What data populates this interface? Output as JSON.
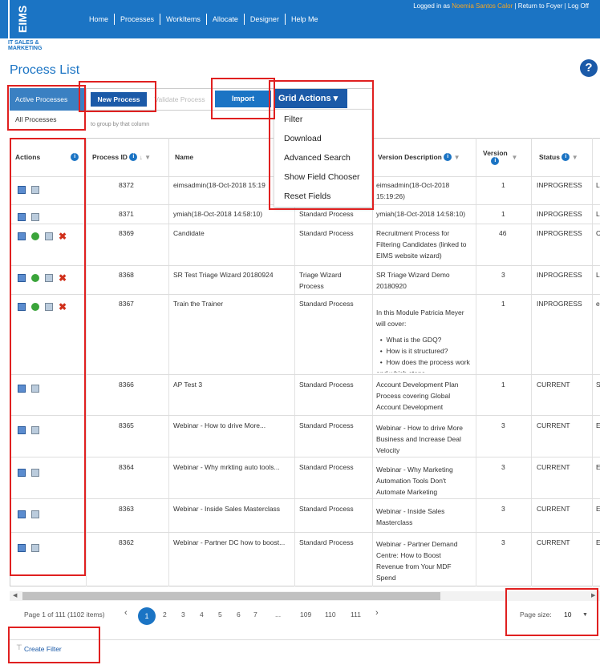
{
  "header": {
    "logo": "EIMS",
    "logo_sub": "IT SALES & MARKETING",
    "nav": [
      "Home",
      "Processes",
      "WorkItems",
      "Allocate",
      "Designer",
      "Help Me"
    ],
    "user_prefix": "Logged in as ",
    "user_name": "Noemia Santos Calor",
    "user_links": " | Return to Foyer | Log Off"
  },
  "page": {
    "title": "Process List",
    "help": "?"
  },
  "tabs": {
    "active": "Active Processes",
    "all": "All Processes"
  },
  "toolbar": {
    "new_process": "New Process",
    "validate": "Validate Process",
    "import": "Import",
    "grid_actions": "Grid Actions ▾",
    "group_hint": "to group by that column"
  },
  "grid_menu": [
    "Filter",
    "Download",
    "Advanced Search",
    "Show Field Chooser",
    "Reset Fields"
  ],
  "columns": {
    "actions": "Actions",
    "process_id": "Process ID",
    "name": "Name",
    "version_description": "Version Description",
    "version": "Version",
    "status": "Status"
  },
  "rows": [
    {
      "id": "8372",
      "name": "eimsadmin(18-Oct-2018 15:19",
      "type": "",
      "desc": "eimsadmin(18-Oct-2018 15:19:26)",
      "version": "1",
      "status": "INPROGRESS",
      "extra": "L"
    },
    {
      "id": "8371",
      "name": "ymiah(18-Oct-2018 14:58:10)",
      "type": "Standard Process",
      "desc": "ymiah(18-Oct-2018 14:58:10)",
      "version": "1",
      "status": "INPROGRESS",
      "extra": "L"
    },
    {
      "id": "8369",
      "name": "Candidate",
      "type": "Standard Process",
      "desc": "Recruitment Process for Filtering Candidates (linked to EIMS website wizard)",
      "version": "46",
      "status": "INPROGRESS",
      "extra": "C"
    },
    {
      "id": "8368",
      "name": "SR Test Triage Wizard 20180924",
      "type": "Triage Wizard Process",
      "desc": "SR Triage Wizard Demo 20180920",
      "version": "3",
      "status": "INPROGRESS",
      "extra": "L"
    },
    {
      "id": "8367",
      "name": "Train the Trainer",
      "type": "Standard Process",
      "desc": "In this Module Patricia Meyer will cover:",
      "version": "1",
      "status": "INPROGRESS",
      "extra": "e"
    },
    {
      "id": "8366",
      "name": "AP Test 3",
      "type": "Standard Process",
      "desc": "Account Development Plan Process covering Global Account Development",
      "version": "1",
      "status": "CURRENT",
      "extra": "S"
    },
    {
      "id": "8365",
      "name": "Webinar - How to drive More...",
      "type": "Standard Process",
      "desc": "Webinar - How to drive More Business and Increase Deal Velocity",
      "version": "3",
      "status": "CURRENT",
      "extra": "E"
    },
    {
      "id": "8364",
      "name": "Webinar - Why mrkting auto tools...",
      "type": "Standard Process",
      "desc": "Webinar - Why Marketing Automation Tools Don't Automate Marketing",
      "version": "3",
      "status": "CURRENT",
      "extra": "E"
    },
    {
      "id": "8363",
      "name": "Webinar - Inside Sales Masterclass",
      "type": "Standard Process",
      "desc": "Webinar - Inside Sales Masterclass",
      "version": "3",
      "status": "CURRENT",
      "extra": "E"
    },
    {
      "id": "8362",
      "name": "Webinar - Partner DC how to boost...",
      "type": "Standard Process",
      "desc": "Webinar - Partner Demand Centre: How to Boost Revenue from Your MDF Spend",
      "version": "3",
      "status": "CURRENT",
      "extra": "E"
    }
  ],
  "bullets": [
    "What is the GDQ?",
    "How is it structured?",
    "How does the process work and which steps"
  ],
  "pager": {
    "summary": "Page 1 of 111 (1102 items)",
    "pages": [
      "1",
      "2",
      "3",
      "4",
      "5",
      "6",
      "7",
      "...",
      "109",
      "110",
      "111"
    ],
    "prev": "‹",
    "next": "›",
    "size_label": "Page size:",
    "size_value": "10"
  },
  "footer": {
    "create_filter": "Create Filter"
  }
}
